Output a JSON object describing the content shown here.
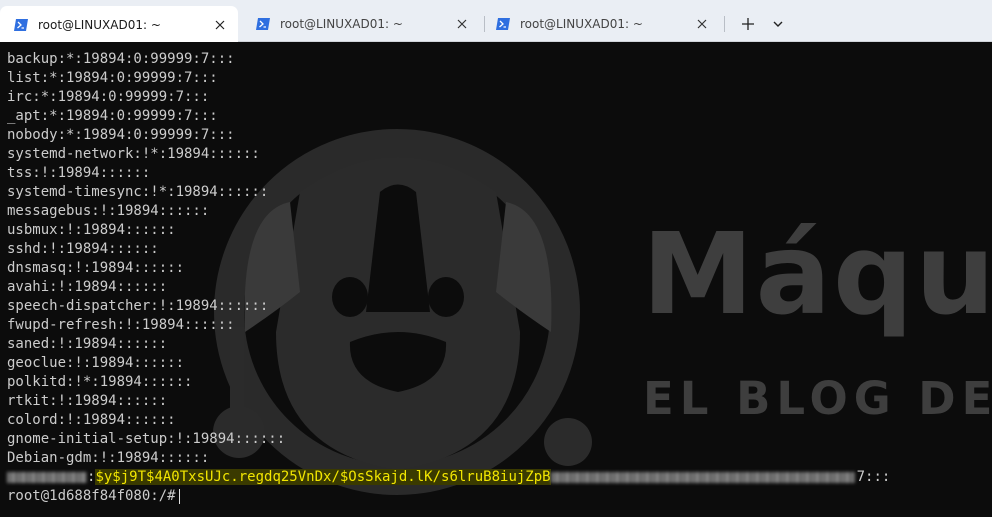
{
  "tabs": [
    {
      "title": "root@LINUXAD01: ~",
      "active": true,
      "icon": "powershell-icon"
    },
    {
      "title": "root@LINUXAD01: ~",
      "active": false,
      "icon": "powershell-icon"
    },
    {
      "title": "root@LINUXAD01: ~",
      "active": false,
      "icon": "powershell-icon"
    }
  ],
  "tab_actions": {
    "new_tab": "+",
    "dropdown": "⌄"
  },
  "background": {
    "brand": "Máqu",
    "tagline": "EL BLOG DE NE"
  },
  "terminal": {
    "lines": [
      "backup:*:19894:0:99999:7:::",
      "list:*:19894:0:99999:7:::",
      "irc:*:19894:0:99999:7:::",
      "_apt:*:19894:0:99999:7:::",
      "nobody:*:19894:0:99999:7:::",
      "systemd-network:!*:19894::::::",
      "tss:!:19894::::::",
      "systemd-timesync:!*:19894::::::",
      "messagebus:!:19894::::::",
      "usbmux:!:19894::::::",
      "sshd:!:19894::::::",
      "dnsmasq:!:19894::::::",
      "avahi:!:19894::::::",
      "speech-dispatcher:!:19894::::::",
      "fwupd-refresh:!:19894::::::",
      "saned:!:19894::::::",
      "geoclue:!:19894::::::",
      "polkitd:!*:19894::::::",
      "rtkit:!:19894::::::",
      "colord:!:19894::::::",
      "gnome-initial-setup:!:19894::::::",
      "Debian-gdm:!:19894::::::"
    ],
    "hash_line": {
      "sep": ":",
      "hash_visible": "$y$j9T$4A0TxsUJc.regdq25VnDx/$OsSkajd.lK/s6lruB8iujZpB",
      "suffix": "7:::"
    },
    "prompt": "root@1d688f84f080:/#"
  },
  "colors": {
    "terminal_bg": "#0c0c0c",
    "terminal_fg": "#cccccc",
    "highlight_fg": "#f2e600",
    "highlight_bg": "#3a3a00",
    "tabbar_bg": "#eaeef4",
    "powershell_blue": "#2f6fe0"
  }
}
